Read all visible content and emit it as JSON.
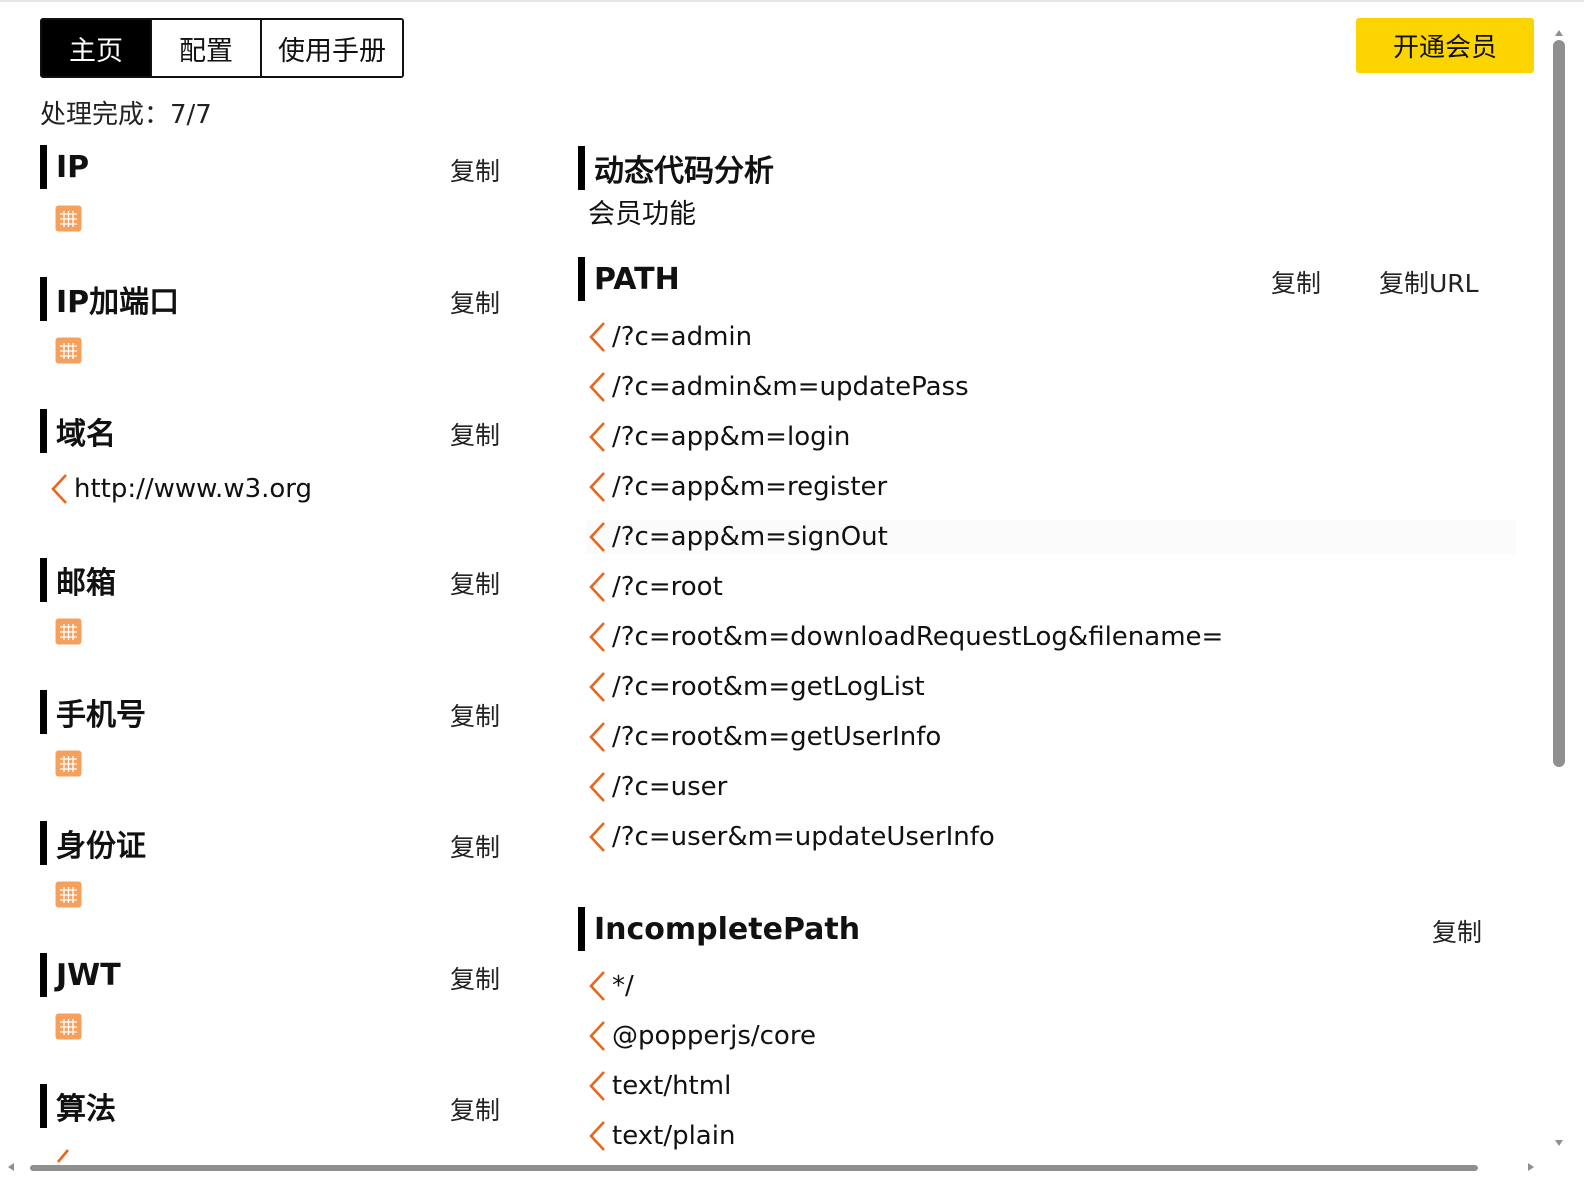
{
  "tabs": [
    "主页",
    "配置",
    "使用手册"
  ],
  "vip_button": "开通会员",
  "status": "处理完成：7/7",
  "copy_label": "复制",
  "copy_url_label": "复制URL",
  "left_sections": [
    {
      "title": "IP",
      "items": []
    },
    {
      "title": "IP加端口",
      "items": []
    },
    {
      "title": "域名",
      "items": [
        "http://www.w3.org"
      ]
    },
    {
      "title": "邮箱",
      "items": []
    },
    {
      "title": "手机号",
      "items": []
    },
    {
      "title": "身份证",
      "items": []
    },
    {
      "title": "JWT",
      "items": []
    },
    {
      "title": "算法",
      "items": []
    }
  ],
  "dynamic": {
    "title": "动态代码分析",
    "note": "会员功能"
  },
  "path": {
    "title": "PATH",
    "items": [
      "/?c=admin",
      "/?c=admin&m=updatePass",
      "/?c=app&m=login",
      "/?c=app&m=register",
      "/?c=app&m=signOut",
      "/?c=root",
      "/?c=root&m=downloadRequestLog&filename=",
      "/?c=root&m=getLogList",
      "/?c=root&m=getUserInfo",
      "/?c=user",
      "/?c=user&m=updateUserInfo"
    ]
  },
  "incomplete_path": {
    "title": "IncompletePath",
    "items": [
      "*/",
      "@popperjs/core",
      "text/html",
      "text/plain"
    ]
  },
  "colors": {
    "accent": "#e8671c",
    "vip": "#fcd400",
    "empty_icon": "#f6a05e"
  },
  "icons": {
    "chevron": "chevron-left-icon",
    "empty": "empty-grid-icon"
  }
}
